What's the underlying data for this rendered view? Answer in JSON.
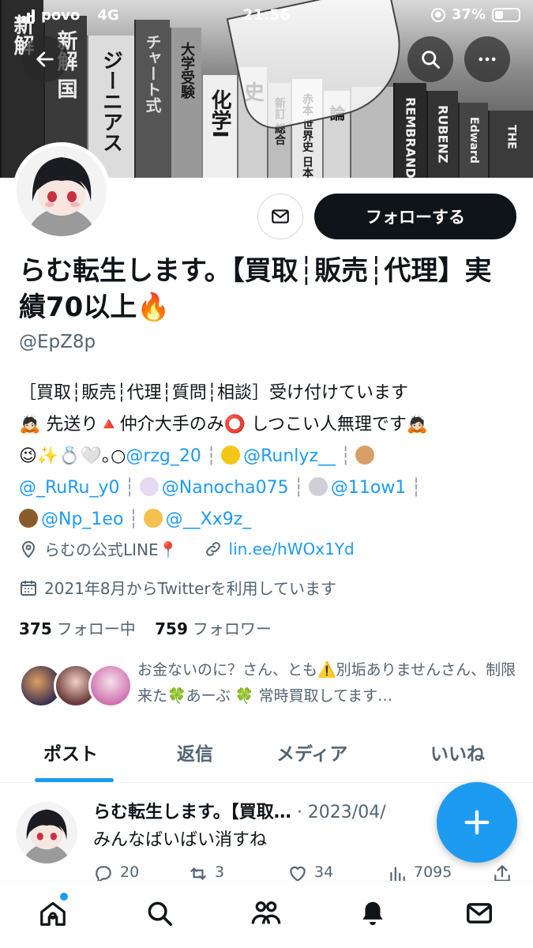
{
  "status_bar": {
    "carrier": "povo",
    "network": "4G",
    "time": "21:56",
    "battery": "37%"
  },
  "banner": {
    "book_titles": [
      "新解",
      "新解 国",
      "ジーニアス",
      "チャート式",
      "大学受験",
      "化学I",
      "史",
      "新訂 総合",
      "赤本 世界史 日本",
      "論",
      "REMBRANDT",
      "RUBENZ",
      "Edward",
      "THE"
    ]
  },
  "header": {
    "back_icon": "arrow-left-icon",
    "search_icon": "search-icon",
    "more_icon": "more-icon"
  },
  "profile": {
    "name": "らむ転生します。【買取┆販売┆代理】実績70以上🔥",
    "handle": "@EpZ8p",
    "follow_label": "フォローする",
    "bio": {
      "line1": "［買取┆販売┆代理┆質問┆相談］受け付けています",
      "line2": "🙇🏻 先送り🔺仲介大手のみ⭕️ しつこい人無理です🙇🏻",
      "line3_prefix": "😉✨💍🤍｡○",
      "mentions": [
        "@rzg_20",
        "@Runlyz__",
        "@_RuRu_y0",
        "@Nanocha075",
        "@11ow1",
        "@Np_1eo",
        "@__Xx9z_"
      ],
      "separator": "┆"
    },
    "location": "らむの公式LINE📍",
    "link": "lin.ee/hWOx1Yd",
    "joined": "2021年8月からTwitterを利用しています",
    "following_count": "375",
    "following_label": "フォロー中",
    "followers_count": "759",
    "followers_label": "フォロワー",
    "followed_by_text": "お金ないのに？さん、とも⚠️別垢ありませんさん、制限来た🍀あーぶ 🍀 常時買取してます…"
  },
  "tabs": [
    {
      "label": "ポスト",
      "active": true
    },
    {
      "label": "返信",
      "active": false
    },
    {
      "label": "メディア",
      "active": false
    },
    {
      "label": "いいね",
      "active": false
    }
  ],
  "post": {
    "author": "らむ転生します。【買取…",
    "date": "· 2023/04/",
    "text": "みんなばいばい消すね",
    "replies": "20",
    "reposts": "3",
    "likes": "34",
    "views": "7095"
  },
  "colors": {
    "accent": "#1d9bf0",
    "text": "#0f1419",
    "muted": "#536471"
  }
}
